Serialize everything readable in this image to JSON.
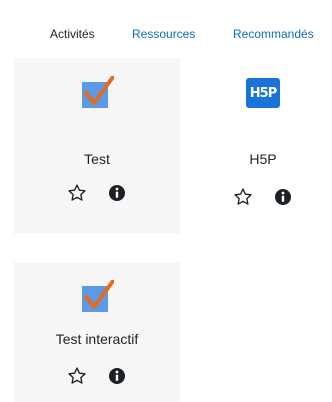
{
  "tabs": [
    {
      "label": "Activités",
      "active": true
    },
    {
      "label": "Ressources",
      "active": false
    },
    {
      "label": "Recommandés",
      "active": false
    }
  ],
  "cards": [
    {
      "label": "Test",
      "icon": "quiz-checkbox-icon"
    },
    {
      "label": "H5P",
      "icon": "h5p-icon",
      "badge_text": "H5P"
    },
    {
      "label": "Test interactif",
      "icon": "quiz-checkbox-icon"
    }
  ],
  "colors": {
    "link": "#0f6cbf",
    "text": "#1d2125",
    "card_background": "#f7f7f7",
    "quiz_icon_box": "#5a9ae8",
    "quiz_icon_check": "#e86a1c",
    "h5p_badge": "#1a73d9",
    "action_icon": "#1d2125"
  }
}
